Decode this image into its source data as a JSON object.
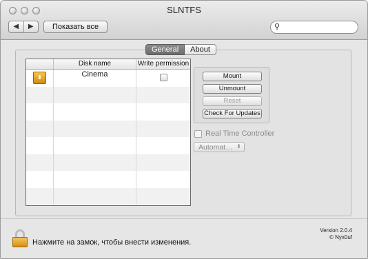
{
  "window": {
    "title": "SLNTFS"
  },
  "toolbar": {
    "back_icon": "◀",
    "forward_icon": "▶",
    "show_all_label": "Показать все",
    "search": {
      "value": "",
      "placeholder": "",
      "icon": "search-icon"
    }
  },
  "tabs": [
    {
      "label": "General",
      "active": true
    },
    {
      "label": "About",
      "active": false
    }
  ],
  "table": {
    "columns": [
      "",
      "Disk name",
      "Write permission"
    ],
    "rows": [
      {
        "icon": "disk-icon",
        "name": "Cinema",
        "write_permission": false
      }
    ],
    "empty_rows": 7
  },
  "buttons": {
    "mount": "Mount",
    "unmount": "Unmount",
    "reset": "Reset",
    "check_updates": "Check For Updates"
  },
  "real_time_controller": {
    "label": "Real Time Controller",
    "checked": false
  },
  "mode_popup": {
    "value": "Automat…",
    "arrow": "⬍"
  },
  "footer": {
    "lock_text": "Нажмите на замок, чтобы внести изменения.",
    "version": "Version 2.0.4",
    "copyright": "© Nyx0uf"
  },
  "colors": {
    "active_tab": "#7a7a7a",
    "lock_body": "#e3a52e",
    "disk_icon": "#e8a52a"
  }
}
